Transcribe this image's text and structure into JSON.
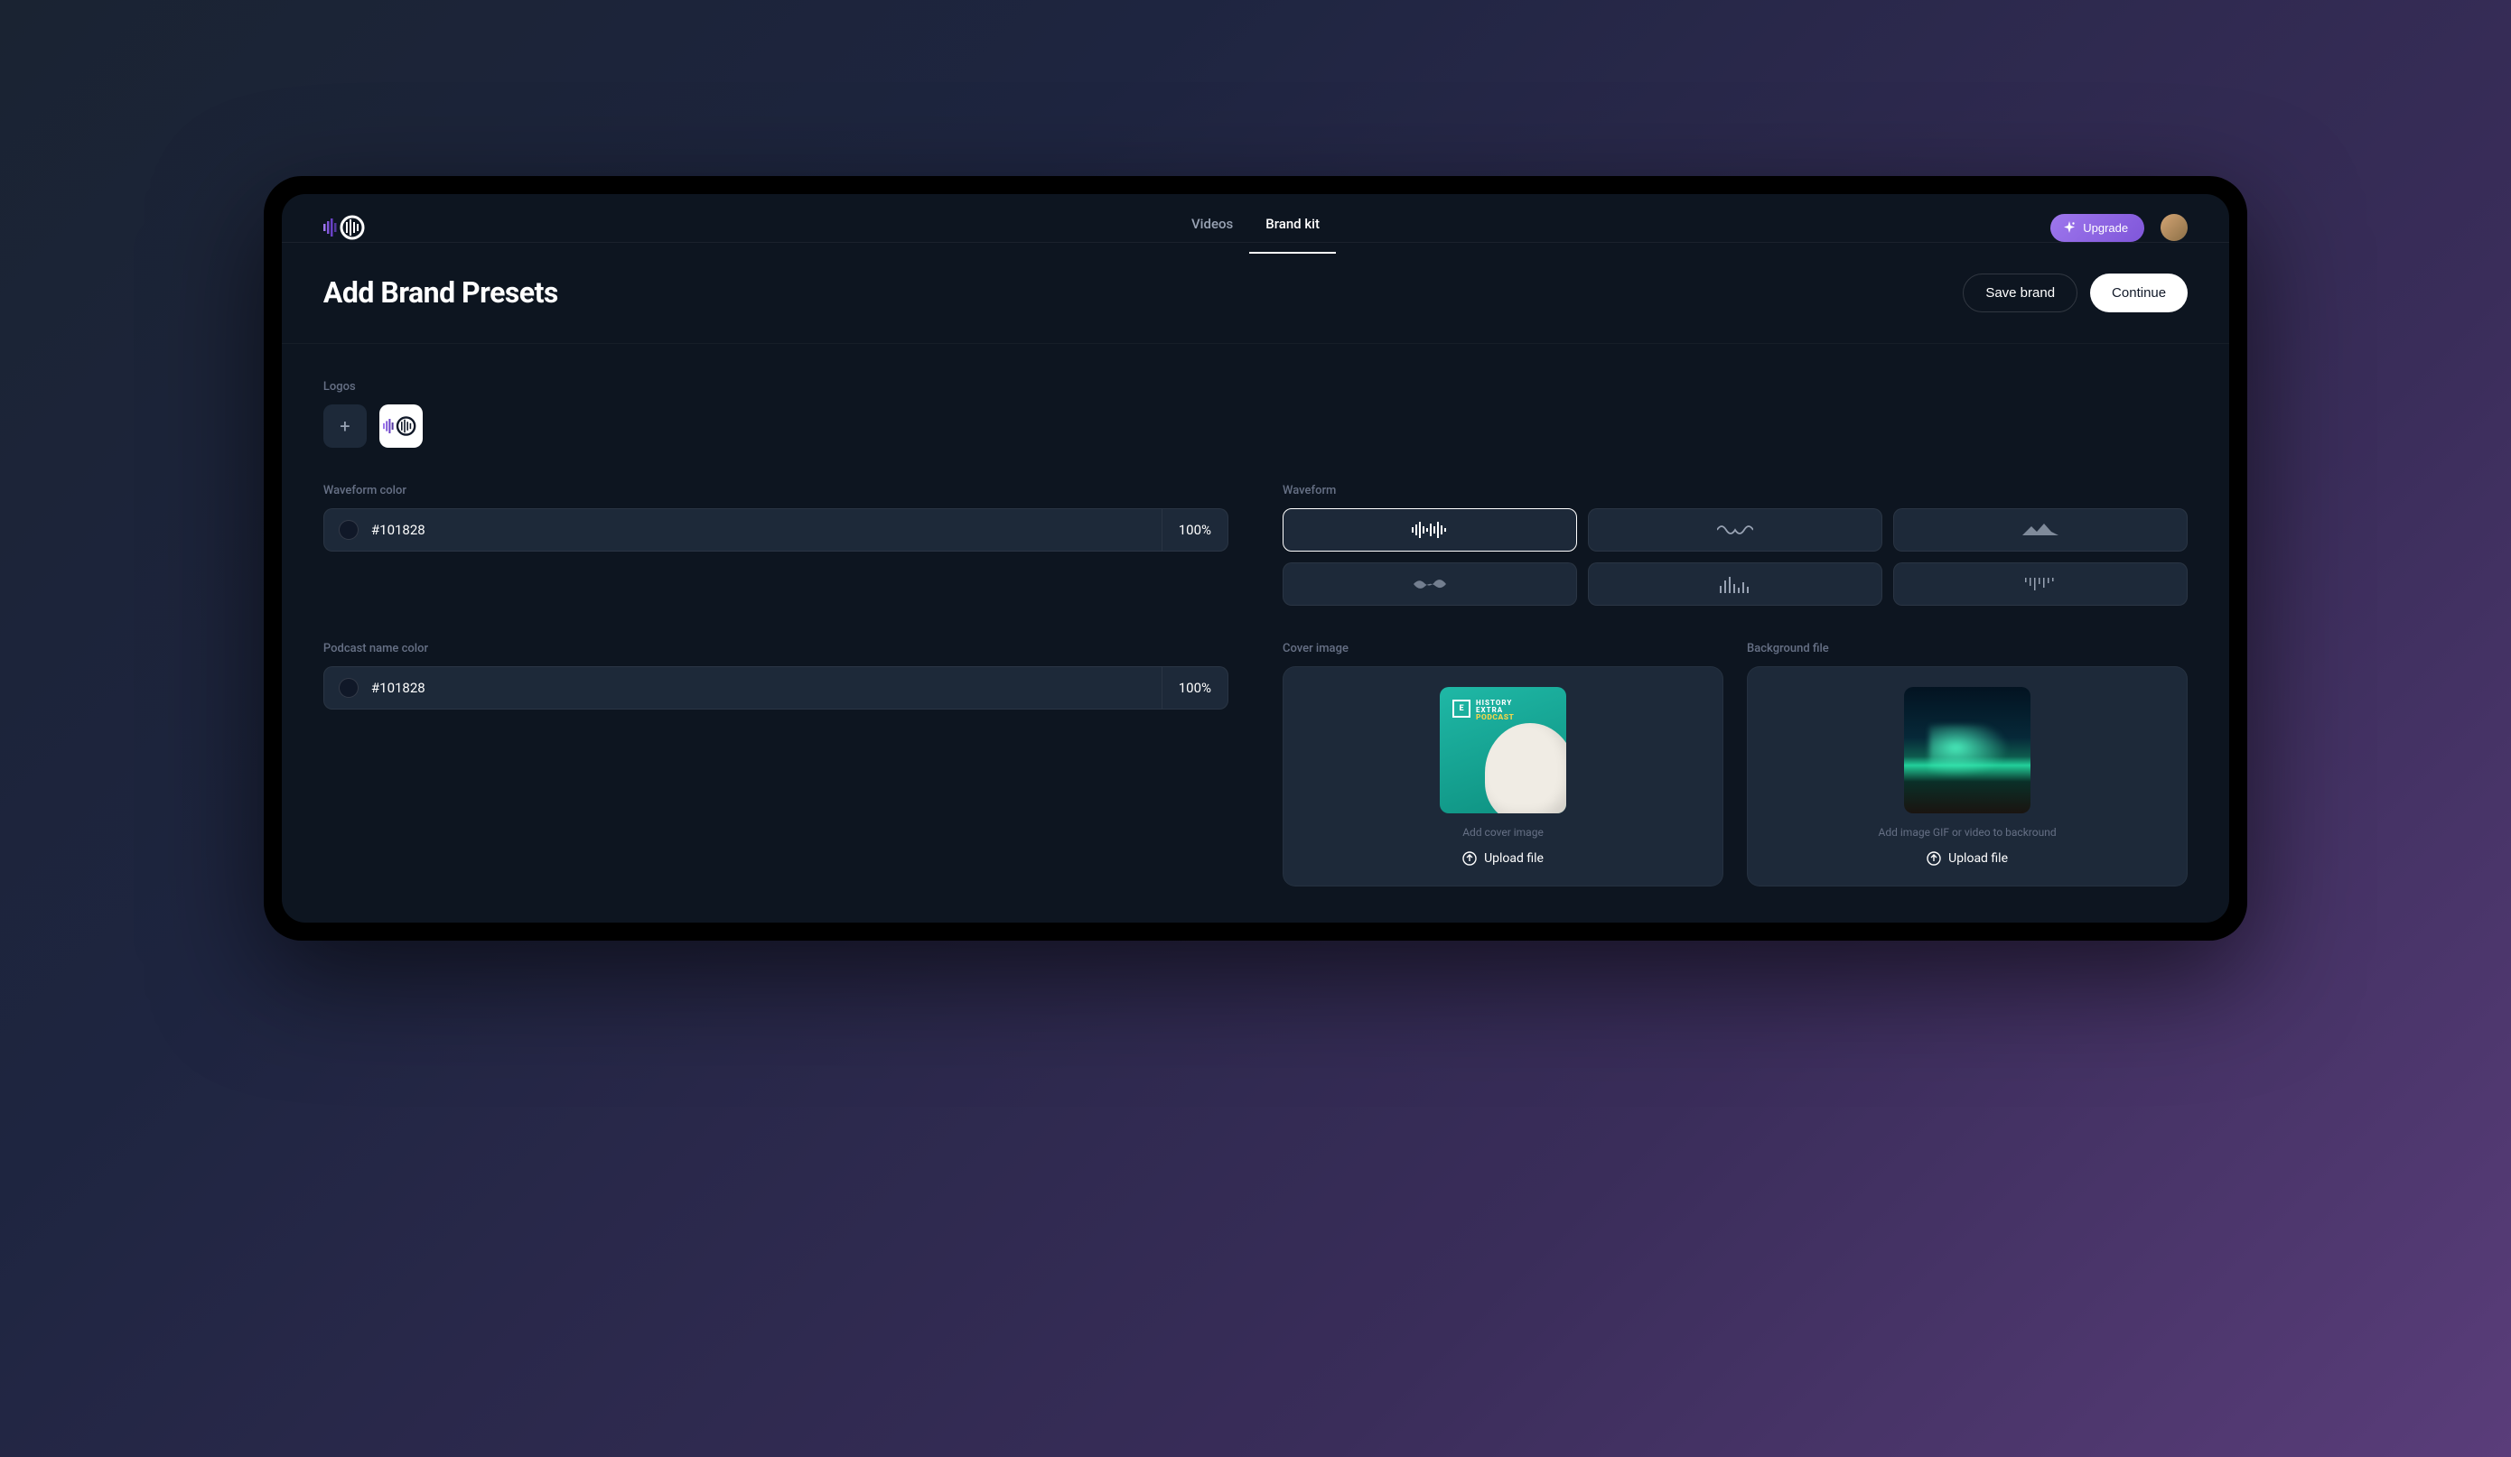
{
  "nav": {
    "tabs": [
      {
        "label": "Videos",
        "active": false
      },
      {
        "label": "Brand kit",
        "active": true
      }
    ],
    "upgrade_label": "Upgrade"
  },
  "header": {
    "title": "Add Brand Presets",
    "save_label": "Save brand",
    "continue_label": "Continue"
  },
  "logos": {
    "label": "Logos"
  },
  "waveform_color": {
    "label": "Waveform color",
    "hex": "#101828",
    "opacity": "100%"
  },
  "podcast_name_color": {
    "label": "Podcast name color",
    "hex": "#101828",
    "opacity": "100%"
  },
  "waveform": {
    "label": "Waveform"
  },
  "cover": {
    "label": "Cover image",
    "thumb_badge_line1": "HISTORY",
    "thumb_badge_line2": "EXTRA",
    "thumb_badge_line3": "PODCAST",
    "caption": "Add cover image",
    "upload_label": "Upload file"
  },
  "background": {
    "label": "Background file",
    "caption": "Add image GIF or video to backround",
    "upload_label": "Upload file"
  }
}
